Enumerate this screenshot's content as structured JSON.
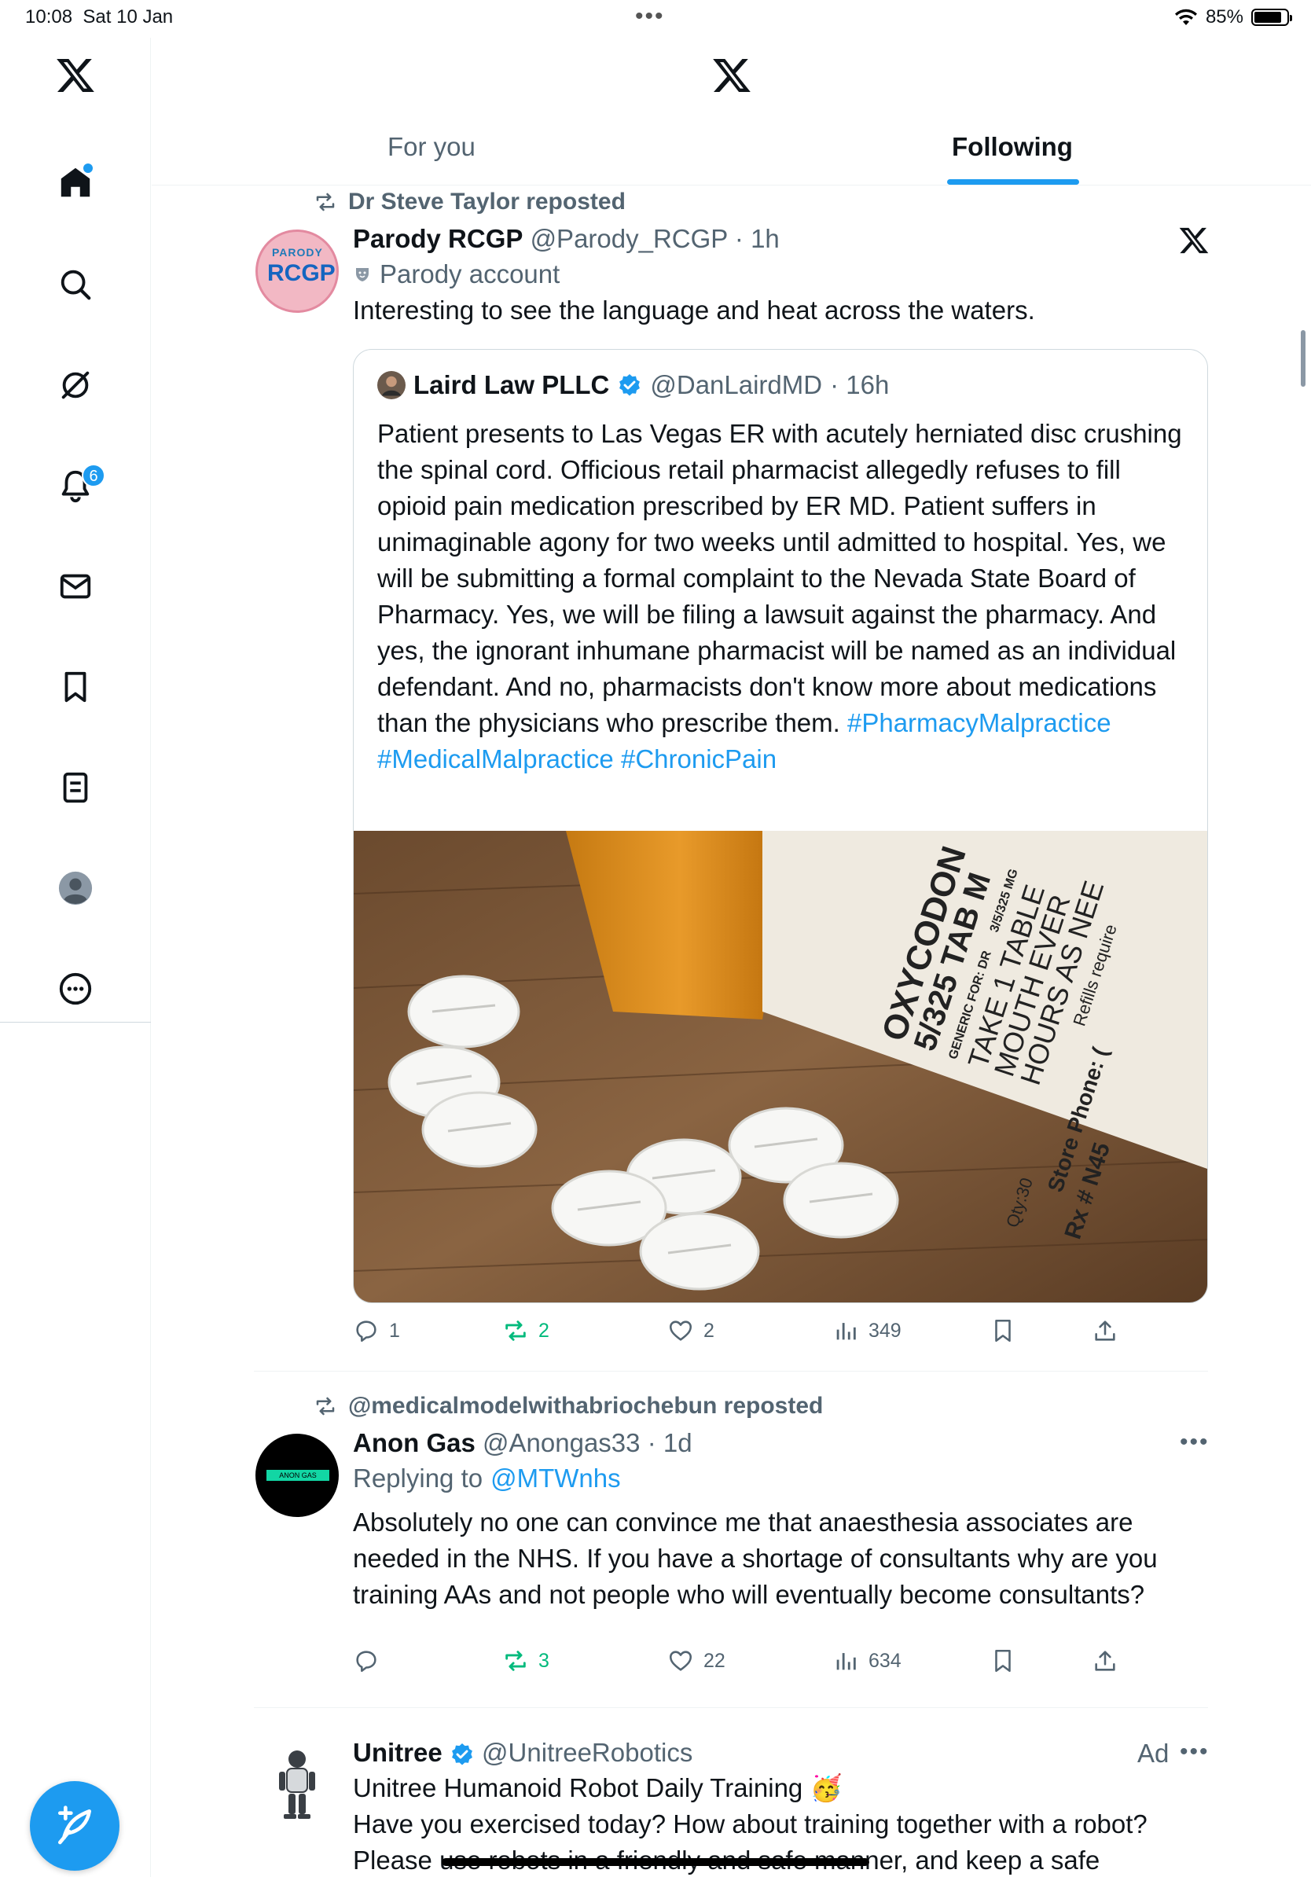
{
  "status_bar": {
    "time": "10:08",
    "date": "Sat 10 Jan",
    "battery": "85%",
    "battery_fraction": 0.85
  },
  "sidebar": {
    "notifications_badge": "6"
  },
  "header": {
    "tabs": [
      {
        "label": "For you",
        "active": false
      },
      {
        "label": "Following",
        "active": true
      }
    ]
  },
  "posts": [
    {
      "repost_by": "Dr Steve Taylor reposted",
      "name": "Parody RCGP",
      "handle": "@Parody_RCGP",
      "time": "· 1h",
      "label": "Parody account",
      "avatar_top": "PARODY",
      "avatar_main": "RCGP",
      "text": "Interesting to see the language and heat across the waters.",
      "quote": {
        "name": "Laird Law PLLC",
        "handle": "@DanLairdMD",
        "time": "· 16h",
        "text": "Patient presents to Las Vegas ER with acutely herniated disc crushing the spinal cord. Officious retail pharmacist allegedly refuses to fill opioid pain medication prescribed by ER MD. Patient suffers in unimaginable agony for two weeks until admitted to hospital. Yes, we will be submitting a formal complaint to the Nevada State Board of Pharmacy. Yes, we will be filing a lawsuit against the pharmacy. And yes, the ignorant inhumane pharmacist will be named as an individual defendant. And no, pharmacists don't know more about medications than the physicians who prescribe them.",
        "hashtags": [
          "#PharmacyMalpractice",
          "#MedicalMalpractice",
          "#ChronicPain"
        ],
        "image_label_lines": [
          "OXYCODON",
          "5/325 TAB M",
          "TAKE 1 TABLE",
          "MOUTH EVER",
          "HOURS AS NEE",
          "Qty:30",
          "Store Phone: (",
          "Rx # N45",
          "Refills require",
          "GENERIC FOR: DR",
          "3/5/325 MG"
        ]
      },
      "stats": {
        "replies": "1",
        "reposts": "2",
        "likes": "2",
        "views": "349"
      }
    },
    {
      "repost_by": "@medicalmodelwithabriochebun reposted",
      "name": "Anon Gas",
      "handle": "@Anongas33",
      "time": "· 1d",
      "avatar_text": "ANON GAS",
      "replying_prefix": "Replying to",
      "replying_to": "@MTWnhs",
      "text": "Absolutely no one can convince me that anaesthesia associates are needed in the NHS. If you have a shortage of consultants why are you training AAs and not people who will eventually become consultants?",
      "stats": {
        "replies": "",
        "reposts": "3",
        "likes": "22",
        "views": "634"
      }
    },
    {
      "name": "Unitree",
      "handle": "@UnitreeRobotics",
      "ad": "Ad",
      "text_line1": "Unitree Humanoid Robot Daily Training 🥳",
      "text": "Have you exercised today? How about training together with a robot? Please use robots in a friendly and safe manner, and keep a safe distance."
    }
  ],
  "colors": {
    "accent": "#1d9bf0",
    "repost_green": "#00ba7c",
    "secondary_text": "#536471"
  }
}
